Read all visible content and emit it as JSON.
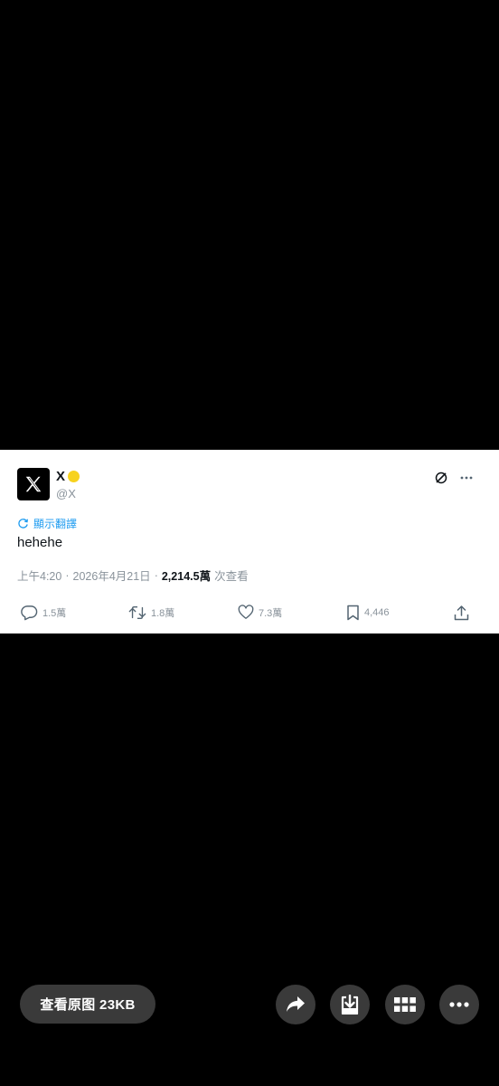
{
  "tweet": {
    "display_name": "X",
    "handle": "@X",
    "translate_label": "顯示翻譯",
    "text": "hehehe",
    "time": "上午4:20",
    "date": "2026年4月21日",
    "separator": "·",
    "views_count": "2,214.5萬",
    "views_label": "次查看",
    "replies": "1.5萬",
    "retweets": "1.8萬",
    "likes": "7.3萬",
    "bookmarks": "4,446",
    "icons": [
      "x-logo-icon",
      "verified-badge-icon",
      "grok-icon",
      "more-icon",
      "translate-icon",
      "reply-icon",
      "retweet-icon",
      "like-icon",
      "bookmark-icon",
      "share-icon"
    ]
  },
  "toolbar": {
    "view_original_label": "查看原图 23KB",
    "buttons": [
      "share-arrow-icon",
      "download-icon",
      "grid-icon",
      "more-horizontal-icon"
    ]
  },
  "colors": {
    "background": "#000000",
    "card": "#ffffff",
    "link_blue": "#1d9bf0",
    "muted": "#8a939b",
    "badge_gold": "#f7d21e",
    "toolbar_button": "#3a3a3a"
  }
}
